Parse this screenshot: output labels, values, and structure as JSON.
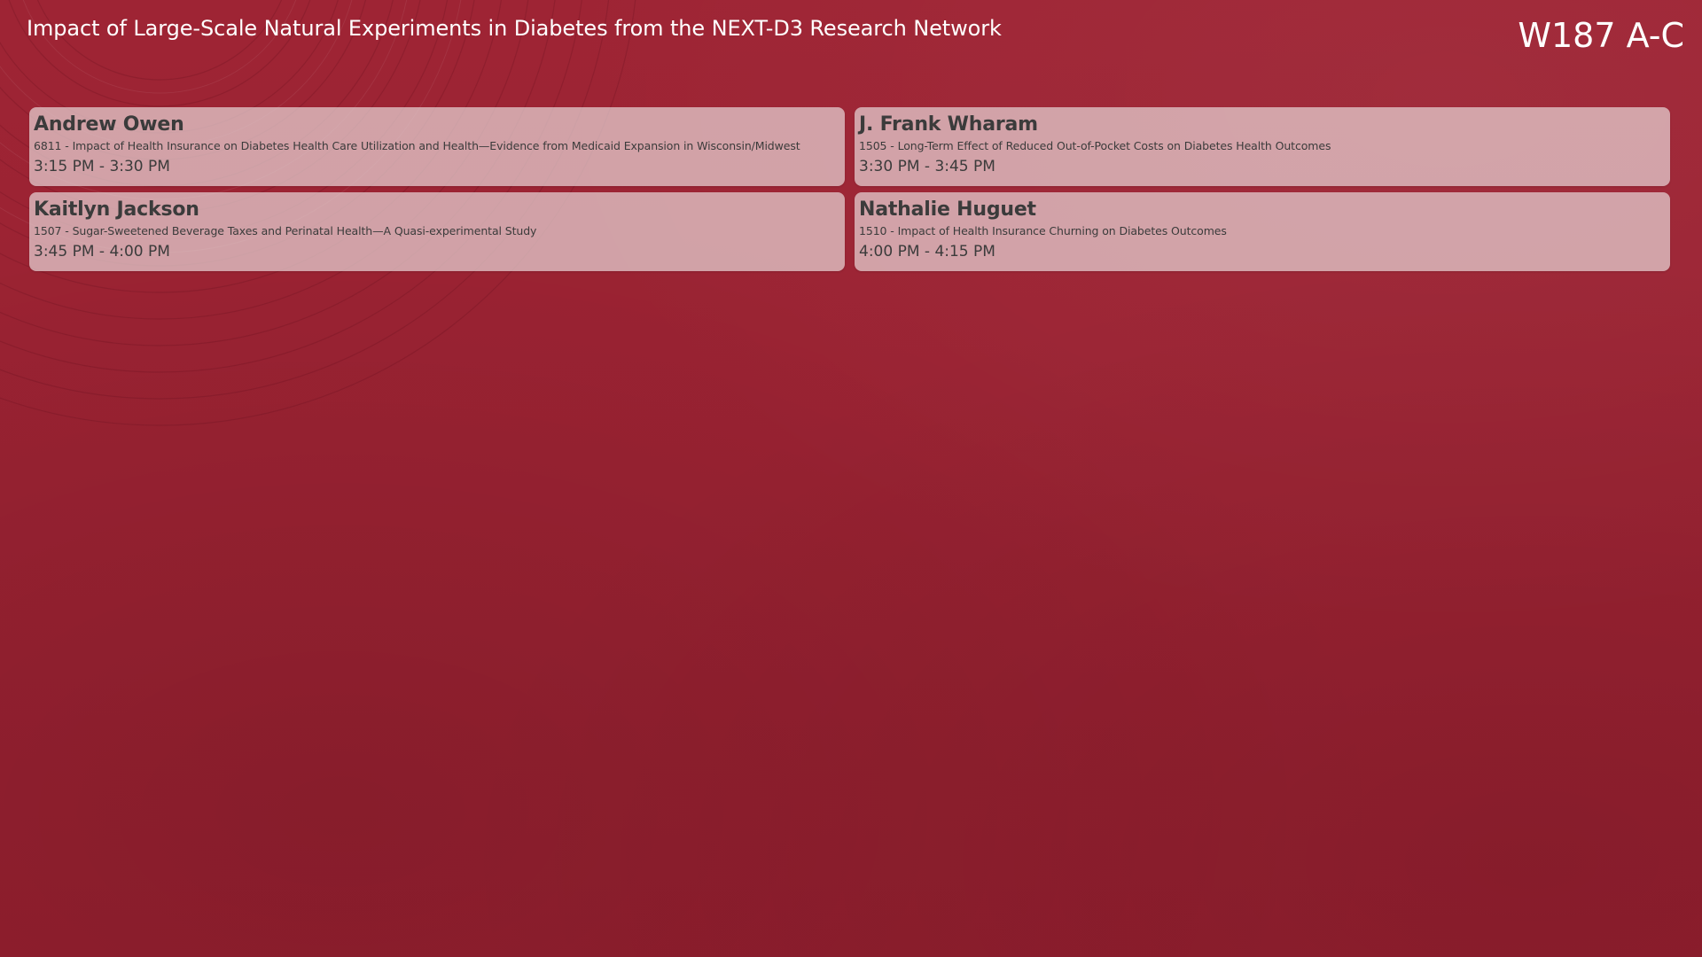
{
  "header": {
    "session_title": "Impact of Large-Scale Natural Experiments in Diabetes from the NEXT-D3 Research Network",
    "room": "W187 A-C"
  },
  "presentations": [
    {
      "speaker": "Andrew Owen",
      "talk": "6811 - Impact of Health Insurance on Diabetes Health Care Utilization and Health—Evidence from Medicaid Expansion in Wisconsin/Midwest",
      "time": "3:15 PM - 3:30 PM"
    },
    {
      "speaker": "J. Frank Wharam",
      "talk": "1505 - Long-Term Effect of Reduced Out-of-Pocket Costs on Diabetes Health Outcomes",
      "time": "3:30 PM - 3:45 PM"
    },
    {
      "speaker": "Kaitlyn Jackson",
      "talk": "1507 - Sugar-Sweetened Beverage Taxes and Perinatal Health—A Quasi-experimental Study",
      "time": "3:45 PM - 4:00 PM"
    },
    {
      "speaker": "Nathalie Huguet",
      "talk": "1510 - Impact of Health Insurance Churning on Diabetes Outcomes",
      "time": "4:00 PM - 4:15 PM"
    }
  ],
  "colors": {
    "background": "#9b2333",
    "card": "#e6d2d4",
    "card_text": "#3b3b3b",
    "header_text": "#ffffff"
  }
}
